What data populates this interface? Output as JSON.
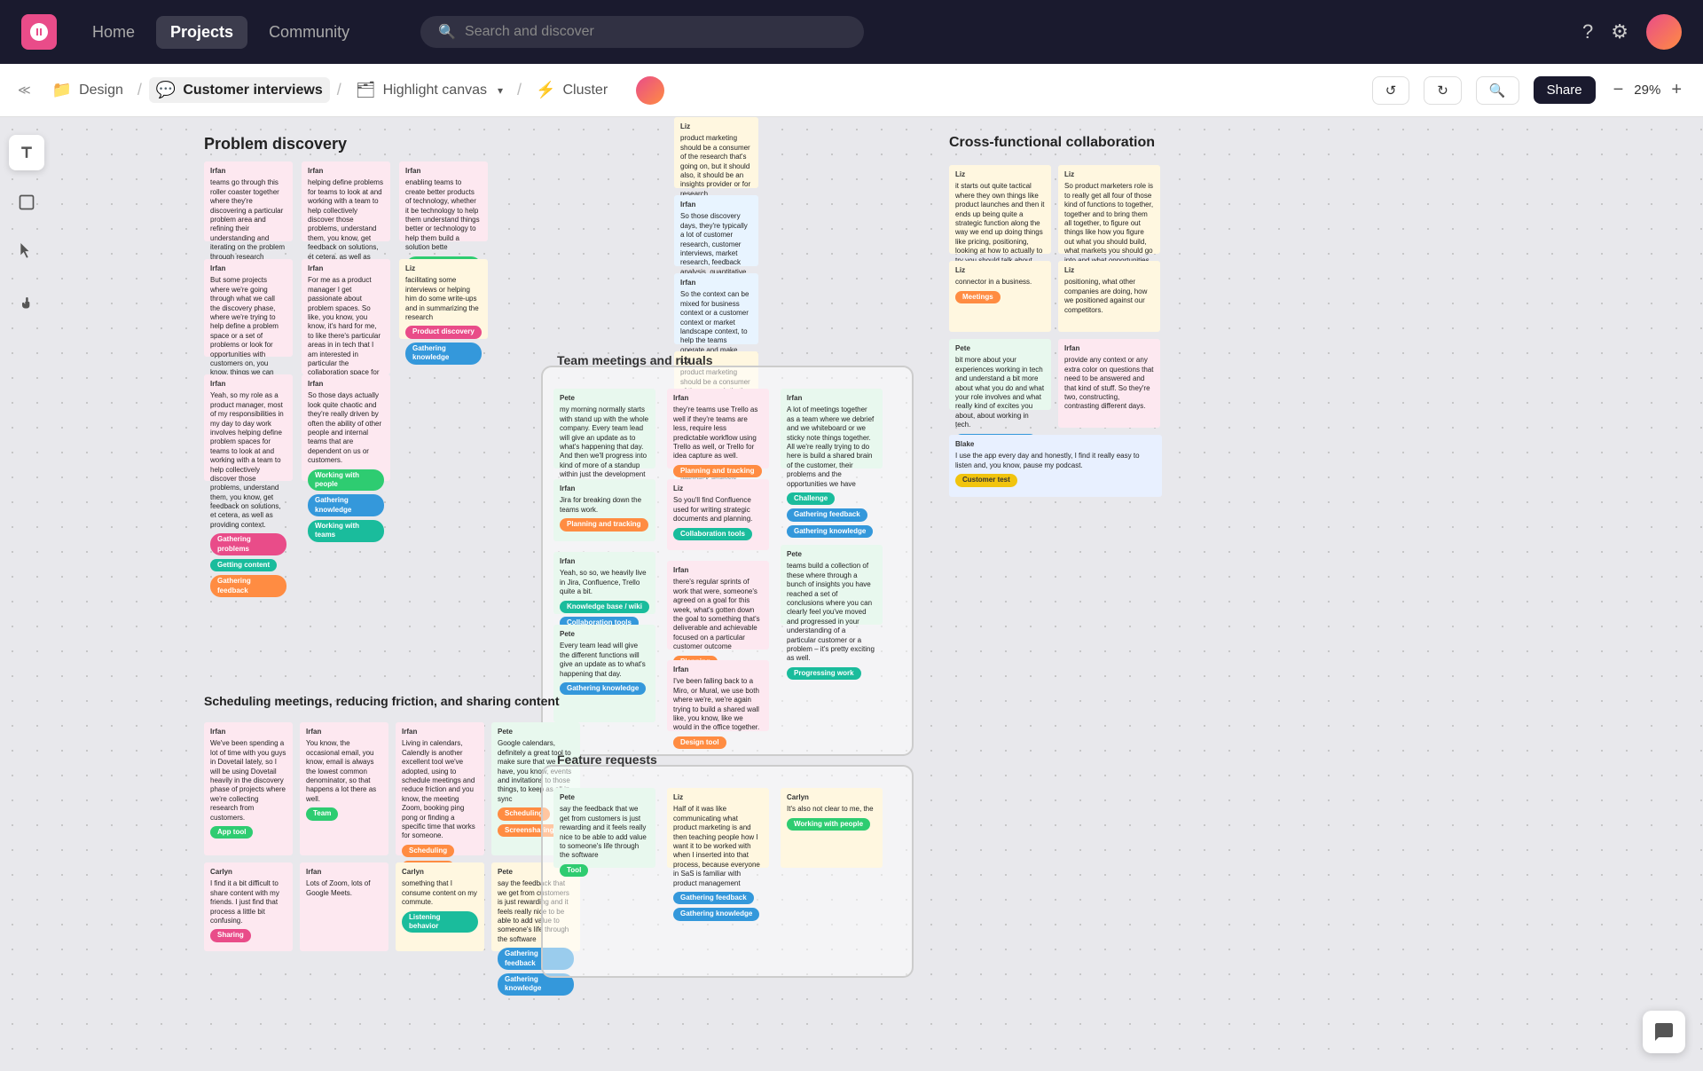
{
  "nav": {
    "logo_alt": "Dovetail logo",
    "links": [
      "Home",
      "Projects",
      "Community"
    ],
    "active_link": "Projects",
    "search_placeholder": "Search and discover",
    "icons": [
      "?",
      "⚙",
      "👤"
    ]
  },
  "breadcrumb": {
    "expand_icon": "≪",
    "items": [
      {
        "icon": "📁",
        "label": "Design"
      },
      {
        "icon": "💬",
        "label": "Customer interviews"
      },
      {
        "icon": "🗂",
        "label": "Highlight canvas",
        "has_dropdown": true
      },
      {
        "icon": "⚡",
        "label": "Cluster"
      },
      {
        "icon": "👤",
        "label": ""
      }
    ],
    "undo": "↺",
    "redo": "↻",
    "search": "🔍",
    "share": "Share",
    "zoom_out": "−",
    "zoom_level": "29%",
    "zoom_in": "+"
  },
  "canvas": {
    "sections": {
      "problem_discovery": "Problem discovery",
      "team_meetings": "Team meetings and rituals",
      "cross_functional": "Cross-functional collaboration",
      "scheduling": "Scheduling meetings, reducing friction, and sharing content",
      "feature_requests": "Feature requests"
    }
  },
  "toolbar": {
    "icons": [
      "T",
      "□",
      "▷",
      "✋"
    ]
  }
}
